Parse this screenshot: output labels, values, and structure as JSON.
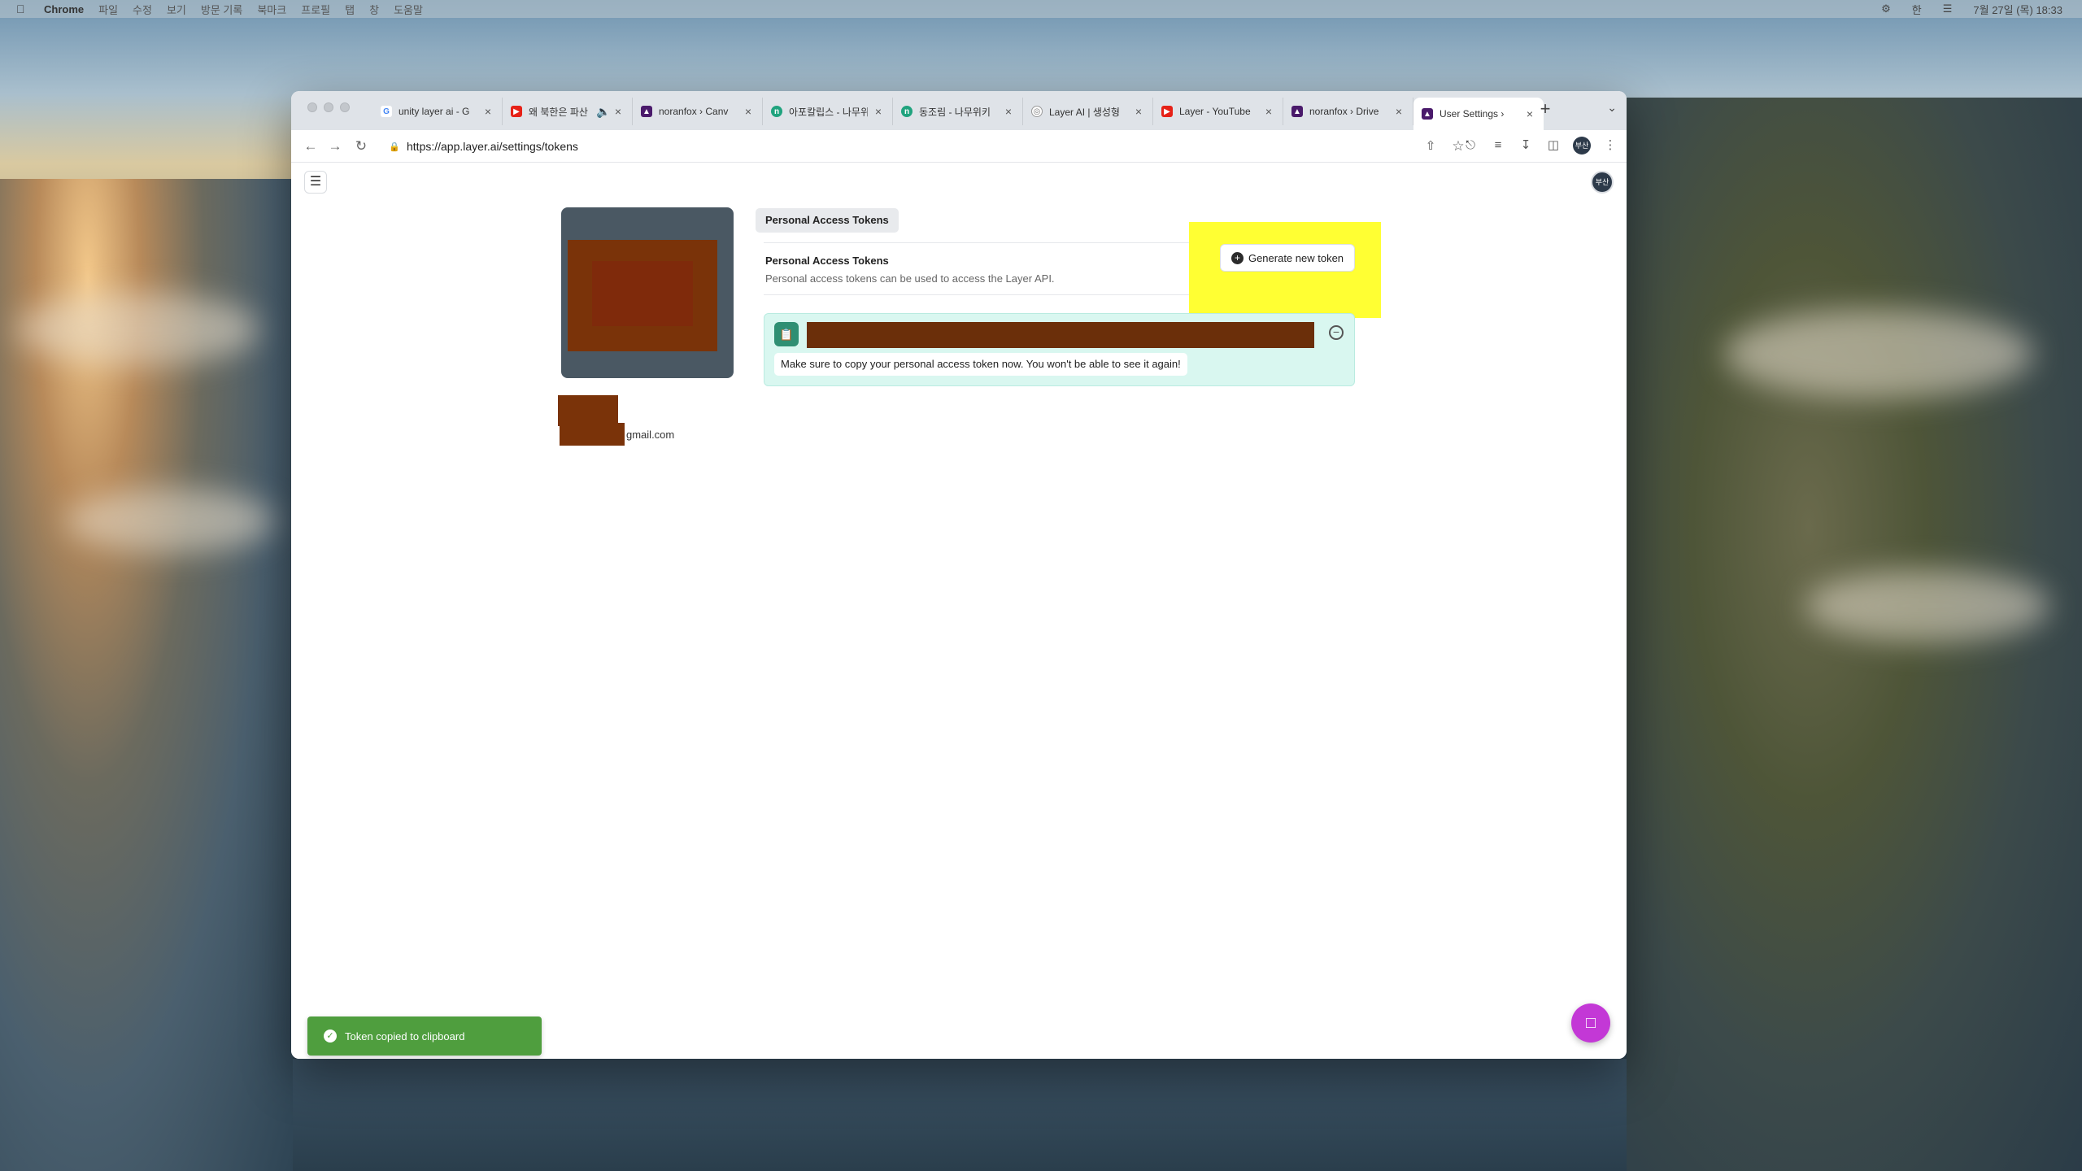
{
  "menubar": {
    "app": "Chrome",
    "items": [
      "파일",
      "수정",
      "보기",
      "방문 기록",
      "북마크",
      "프로필",
      "탭",
      "창",
      "도움말"
    ],
    "input_badge": "한",
    "datetime": "7월 27일 (목) 18:33"
  },
  "browser": {
    "tabs": [
      {
        "title": "unity layer ai - G",
        "favicon": "google-icon",
        "color": "#ffffff"
      },
      {
        "title": "왜 북한은 파산",
        "favicon": "youtube-icon",
        "color": "#e62117"
      },
      {
        "title": "noranfox › Canv",
        "favicon": "layer-icon",
        "color": "#4a1a6b"
      },
      {
        "title": "아포칼립스 - 나무위",
        "favicon": "namuwiki-icon",
        "color": "#1fa37e"
      },
      {
        "title": "동조림 - 나무위키",
        "favicon": "namuwiki-icon",
        "color": "#1fa37e"
      },
      {
        "title": "Layer AI | 생성형",
        "favicon": "layer-globe-icon",
        "color": "#777777"
      },
      {
        "title": "Layer - YouTube",
        "favicon": "youtube-icon",
        "color": "#e62117"
      },
      {
        "title": "noranfox › Drive",
        "favicon": "layer-icon",
        "color": "#4a1a6b"
      },
      {
        "title": "User Settings ›",
        "favicon": "layer-icon",
        "color": "#4a1a6b"
      }
    ],
    "url": "https://app.layer.ai/settings/tokens",
    "profile_badge": "부산"
  },
  "page": {
    "section_tab": "Personal Access Tokens",
    "pat_title": "Personal Access Tokens",
    "pat_description": "Personal access tokens can be used to access the Layer API.",
    "generate_button": "Generate new token",
    "token_warning": "Make sure to copy your personal access token now. You won't be able to see it again!",
    "email_suffix": "gmail.com",
    "toast": "Token copied to clipboard",
    "user_badge": "부산"
  },
  "colors": {
    "highlight": "#ffff33",
    "token_box": "#d9f7f0",
    "toast": "#4f9e3e",
    "chat": "#c338d6",
    "redaction": "#7a3309"
  }
}
